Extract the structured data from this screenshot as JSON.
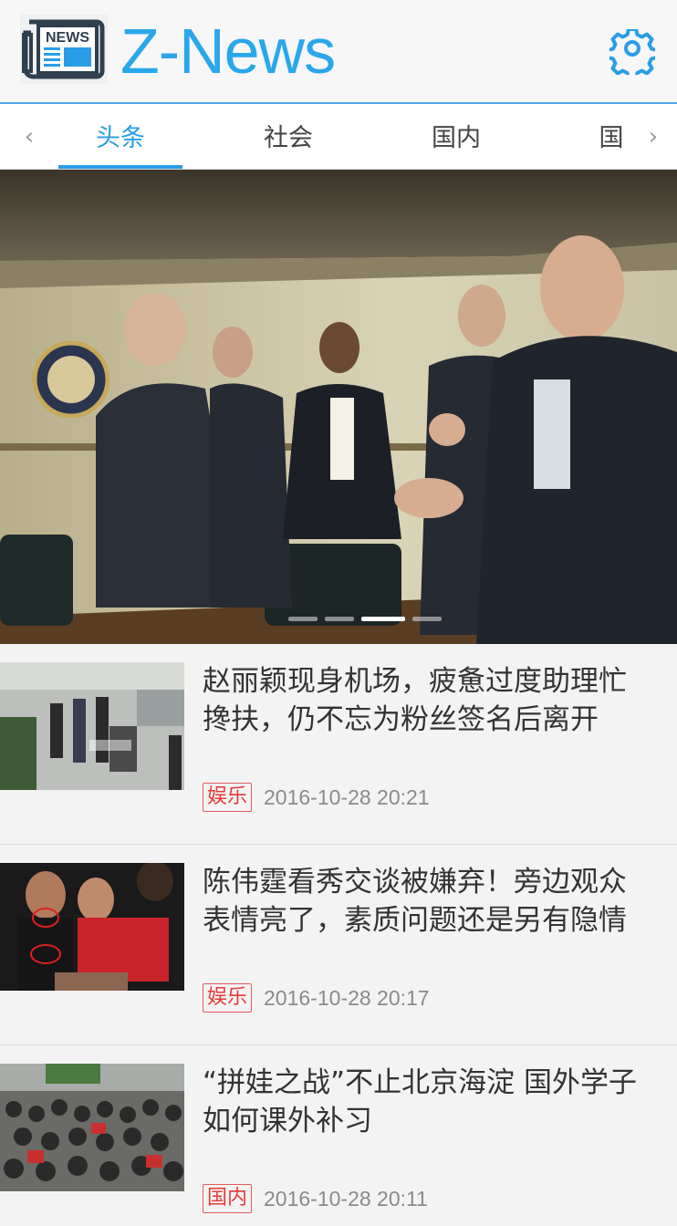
{
  "header": {
    "title": "Z-News",
    "logo_text": "NEWS"
  },
  "colors": {
    "accent": "#2a9de6",
    "tag": "#e33a3a"
  },
  "tabs": [
    {
      "label": "头条",
      "active": true
    },
    {
      "label": "社会",
      "active": false
    },
    {
      "label": "国内",
      "active": false
    },
    {
      "label": "国",
      "active": false
    }
  ],
  "hero": {
    "slides": 4,
    "active_slide": 3
  },
  "news": [
    {
      "title_lines": [
        "赵丽颖现身机场，疲惫过度助理忙",
        "搀扶，仍不忘为粉丝签名后离开"
      ],
      "category": "娱乐",
      "time": "2016-10-28 20:21"
    },
    {
      "title_lines": [
        "陈伟霆看秀交谈被嫌弃！旁边观众",
        "表情亮了，素质问题还是另有隐情"
      ],
      "category": "娱乐",
      "time": "2016-10-28 20:17"
    },
    {
      "title_lines": [
        "“拼娃之战”不止北京海淀 国外学子",
        "如何课外补习"
      ],
      "category": "国内",
      "time": "2016-10-28 20:11"
    }
  ]
}
